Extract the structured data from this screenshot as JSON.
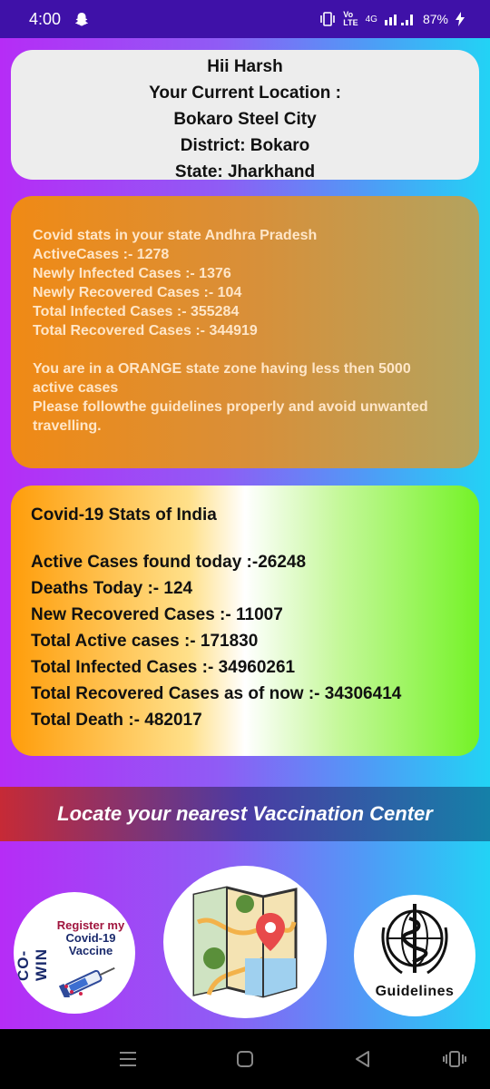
{
  "status_bar": {
    "time": "4:00",
    "battery": "87%",
    "network": "4G"
  },
  "location": {
    "greeting": "Hii Harsh",
    "heading": "Your Current Location :",
    "city": "Bokaro Steel City",
    "district": "District: Bokaro",
    "state": "State: Jharkhand"
  },
  "state_stats": {
    "lines": [
      "Covid stats in your state Andhra Pradesh",
      "ActiveCases :- 1278",
      "Newly Infected Cases :- 1376",
      "Newly Recovered Cases :- 104",
      "Total Infected Cases :- 355284",
      "Total Recovered Cases :- 344919"
    ],
    "zone_lines": [
      "You are in a ORANGE state zone having less then 5000",
      "active cases",
      "Please followthe guidelines properly and avoid unwanted",
      "travelling."
    ]
  },
  "india_stats": {
    "title": "Covid-19 Stats of India",
    "stats": [
      "Active Cases found today :-26248",
      "Deaths Today :- 124",
      "New Recovered Cases :- 11007",
      "Total Active cases :- 171830",
      "Total Infected Cases :- 34960261",
      "Total Recovered Cases as of now :- 34306414",
      "Total Death :- 482017"
    ]
  },
  "banner": {
    "label": "Locate your nearest Vaccination Center"
  },
  "shortcuts": {
    "cowin_brand": "CO-WIN",
    "cowin_line1": "Register my",
    "cowin_line2": "Covid-19",
    "cowin_line3": "Vaccine",
    "guidelines_label": "Guidelines"
  },
  "colors": {
    "status_bar": "#3f11a8",
    "state_card": "#f08a15",
    "banner": "#c62a36"
  }
}
